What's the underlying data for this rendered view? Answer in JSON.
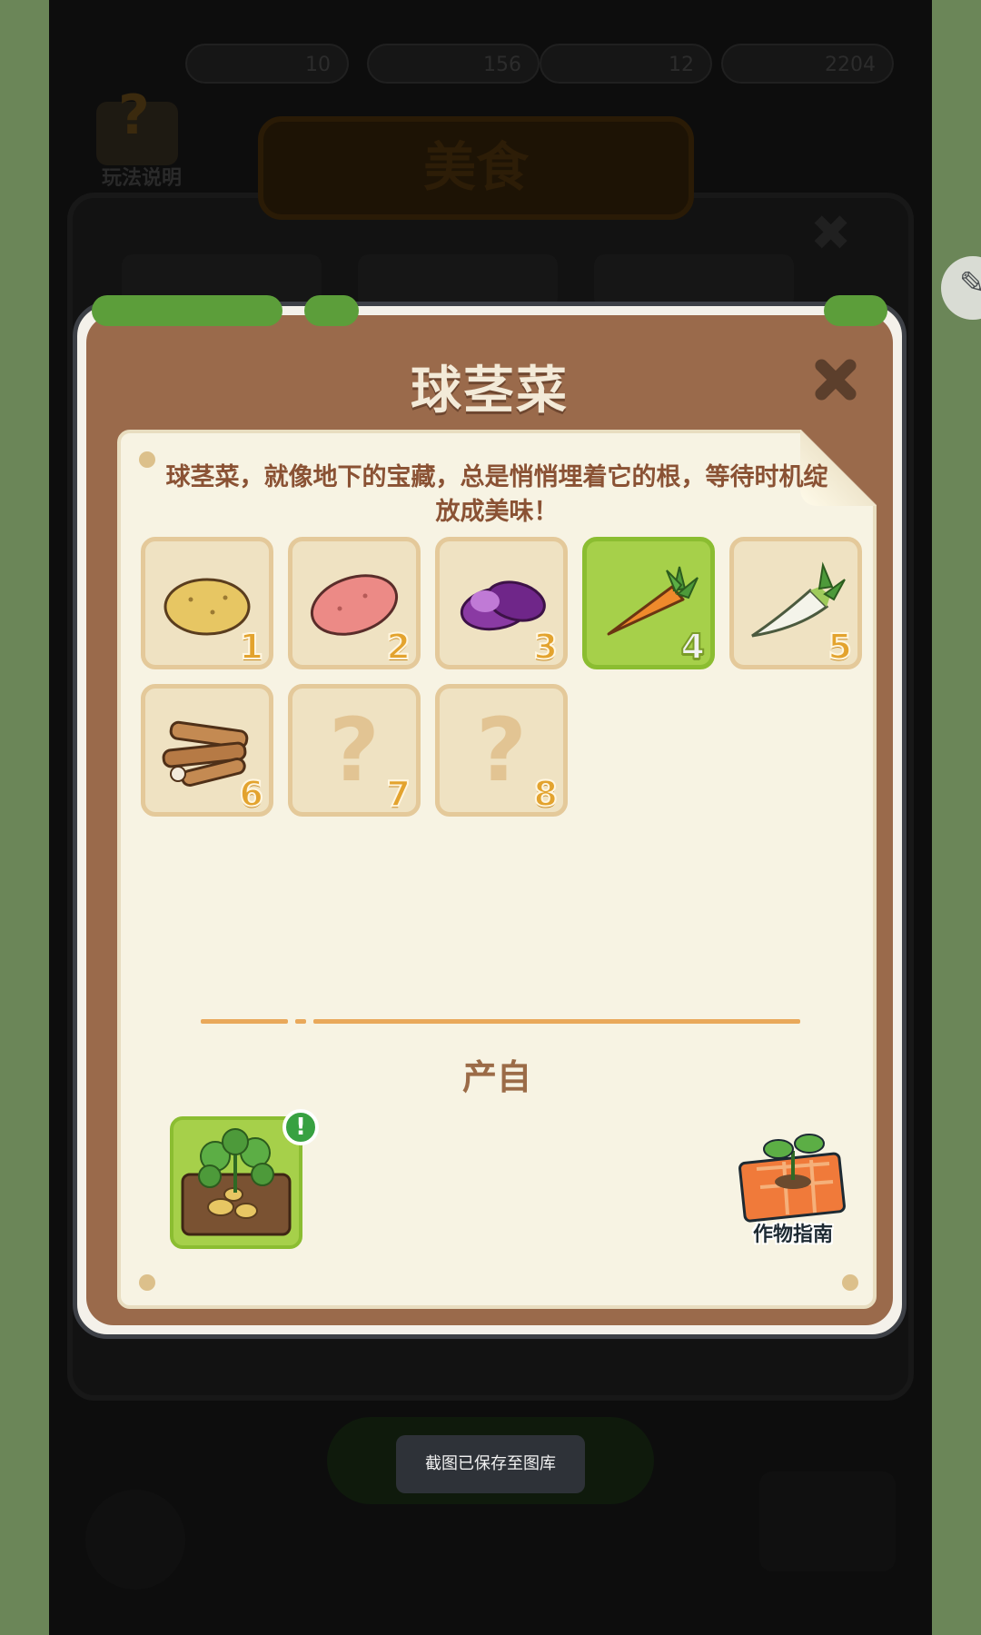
{
  "background": {
    "page_title": "美食",
    "help_label": "玩法说明",
    "stats": [
      "10",
      "156",
      "12",
      "2204"
    ]
  },
  "dialog": {
    "title": "球茎菜",
    "description": "球茎菜，就像地下的宝藏，总是悄悄埋着它的根，等待时机绽放成美味！",
    "items": [
      {
        "number": "1",
        "icon": "potato-icon",
        "unlocked": true,
        "selected": false
      },
      {
        "number": "2",
        "icon": "sweet-potato-icon",
        "unlocked": true,
        "selected": false
      },
      {
        "number": "3",
        "icon": "purple-yam-icon",
        "unlocked": true,
        "selected": false
      },
      {
        "number": "4",
        "icon": "carrot-icon",
        "unlocked": true,
        "selected": true
      },
      {
        "number": "5",
        "icon": "radish-icon",
        "unlocked": true,
        "selected": false
      },
      {
        "number": "6",
        "icon": "yam-roots-icon",
        "unlocked": true,
        "selected": false
      },
      {
        "number": "7",
        "icon": "question-mark-icon",
        "unlocked": false,
        "selected": false
      },
      {
        "number": "8",
        "icon": "question-mark-icon",
        "unlocked": false,
        "selected": false
      }
    ],
    "source_label": "产自",
    "source_item_icon": "potato-field-icon",
    "source_badge": "!",
    "guide_label": "作物指南"
  },
  "toast": "截图已保存至图库",
  "colors": {
    "dialog_frame": "#9a6a4b",
    "paper": "#f7f3e3",
    "selected_cell": "#a6d04a",
    "number": "#e3a32e"
  }
}
